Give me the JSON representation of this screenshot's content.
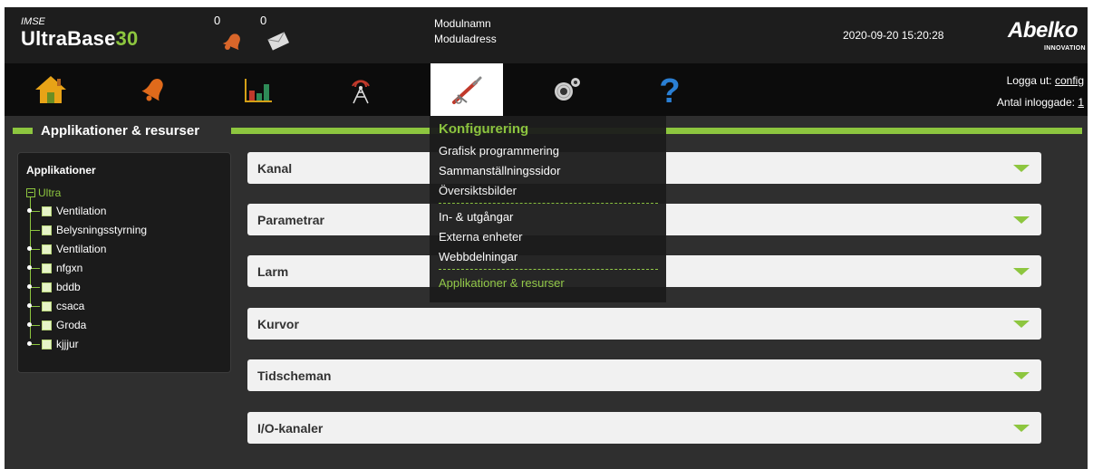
{
  "header": {
    "brand_small": "IMSE",
    "brand_name": "UltraBase",
    "brand_number": "30",
    "alarm_count": "0",
    "message_count": "0",
    "module_name": "Modulnamn",
    "module_address": "Moduladress",
    "datetime": "2020-09-20 15:20:28",
    "logo_text": "Abelko",
    "logo_subtitle": "INNOVATION"
  },
  "nav": {
    "items": [
      "home-icon",
      "alarm-bell-icon",
      "chart-icon",
      "antenna-icon",
      "tools-icon",
      "gears-icon",
      "help-icon"
    ],
    "active_index": 4,
    "logout_label": "Logga ut:",
    "logout_user": "config",
    "logged_in_label": "Antal inloggade:",
    "logged_in_count": "1"
  },
  "section": {
    "title": "Applikationer & resurser"
  },
  "sidebar": {
    "title": "Applikationer",
    "root": "Ultra",
    "items": [
      "Ventilation",
      "Belysningsstyrning",
      "Ventilation",
      "nfgxn",
      "bddb",
      "csaca",
      "Groda",
      "kjjjur"
    ]
  },
  "panels": [
    "Kanal",
    "Parametrar",
    "Larm",
    "Kurvor",
    "Tidscheman",
    "I/O-kanaler"
  ],
  "dropdown": {
    "title": "Konfigurering",
    "group1": [
      "Grafisk programmering",
      "Sammanställningssidor",
      "Översiktsbilder"
    ],
    "group2": [
      "In- & utgångar",
      "Externa enheter",
      "Webbdelningar"
    ],
    "group3": [
      "Applikationer & resurser"
    ]
  },
  "colors": {
    "accent": "#8dc63f",
    "header_bg": "#1d1d1d",
    "nav_bg": "#0c0c0c",
    "body_bg": "#2f2f2f",
    "panel_bg": "#f1f1f1"
  }
}
